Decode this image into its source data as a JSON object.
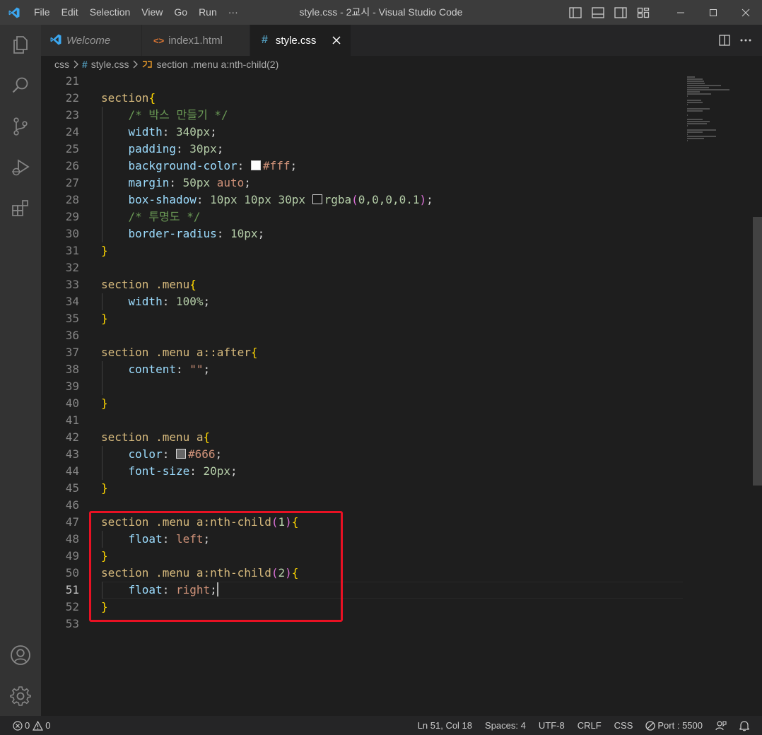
{
  "titlebar": {
    "menu": [
      "File",
      "Edit",
      "Selection",
      "View",
      "Go",
      "Run",
      "···"
    ],
    "title": "style.css - 2교시 - Visual Studio Code"
  },
  "tabs": [
    {
      "label": "Welcome",
      "icon": "vscode-icon",
      "active": false
    },
    {
      "label": "index1.html",
      "icon": "html-icon",
      "active": false
    },
    {
      "label": "style.css",
      "icon": "css-hash-icon",
      "active": true
    }
  ],
  "breadcrumb": {
    "folder": "css",
    "file": "style.css",
    "symbol": "section .menu a:nth-child(2)"
  },
  "editor": {
    "lines": [
      {
        "n": "21",
        "parts": []
      },
      {
        "n": "22",
        "parts": [
          [
            "sel",
            "section"
          ],
          [
            "br1",
            "{"
          ]
        ]
      },
      {
        "n": "23",
        "parts": [
          [
            "ind",
            "    "
          ],
          [
            "com",
            "/* 박스 만들기 */"
          ]
        ]
      },
      {
        "n": "24",
        "parts": [
          [
            "ind",
            "    "
          ],
          [
            "prop",
            "width"
          ],
          [
            "pun",
            ": "
          ],
          [
            "num",
            "340px"
          ],
          [
            "pun",
            ";"
          ]
        ]
      },
      {
        "n": "25",
        "parts": [
          [
            "ind",
            "    "
          ],
          [
            "prop",
            "padding"
          ],
          [
            "pun",
            ": "
          ],
          [
            "num",
            "30px"
          ],
          [
            "pun",
            ";"
          ]
        ]
      },
      {
        "n": "26",
        "parts": [
          [
            "ind",
            "    "
          ],
          [
            "prop",
            "background-color"
          ],
          [
            "pun",
            ": "
          ],
          [
            "swatch",
            "#ffffff"
          ],
          [
            "val",
            "#fff"
          ],
          [
            "pun",
            ";"
          ]
        ]
      },
      {
        "n": "27",
        "parts": [
          [
            "ind",
            "    "
          ],
          [
            "prop",
            "margin"
          ],
          [
            "pun",
            ": "
          ],
          [
            "num",
            "50px "
          ],
          [
            "val",
            "auto"
          ],
          [
            "pun",
            ";"
          ]
        ]
      },
      {
        "n": "28",
        "parts": [
          [
            "ind",
            "    "
          ],
          [
            "prop",
            "box-shadow"
          ],
          [
            "pun",
            ": "
          ],
          [
            "num",
            "10px 10px 30px "
          ],
          [
            "swatch",
            "rgba(0,0,0,0.1)"
          ],
          [
            "fn",
            "rgba"
          ],
          [
            "br2",
            "("
          ],
          [
            "num",
            "0,0,0,0.1"
          ],
          [
            "br2",
            ")"
          ],
          [
            "pun",
            ";"
          ]
        ]
      },
      {
        "n": "29",
        "parts": [
          [
            "ind",
            "    "
          ],
          [
            "com",
            "/* 투명도 */"
          ]
        ]
      },
      {
        "n": "30",
        "parts": [
          [
            "ind",
            "    "
          ],
          [
            "prop",
            "border-radius"
          ],
          [
            "pun",
            ": "
          ],
          [
            "num",
            "10px"
          ],
          [
            "pun",
            ";"
          ]
        ]
      },
      {
        "n": "31",
        "parts": [
          [
            "br1",
            "}"
          ]
        ]
      },
      {
        "n": "32",
        "parts": []
      },
      {
        "n": "33",
        "parts": [
          [
            "sel",
            "section .menu"
          ],
          [
            "br1",
            "{"
          ]
        ]
      },
      {
        "n": "34",
        "parts": [
          [
            "ind",
            "    "
          ],
          [
            "prop",
            "width"
          ],
          [
            "pun",
            ": "
          ],
          [
            "num",
            "100%"
          ],
          [
            "pun",
            ";"
          ]
        ]
      },
      {
        "n": "35",
        "parts": [
          [
            "br1",
            "}"
          ]
        ]
      },
      {
        "n": "36",
        "parts": []
      },
      {
        "n": "37",
        "parts": [
          [
            "sel",
            "section .menu a::after"
          ],
          [
            "br1",
            "{"
          ]
        ]
      },
      {
        "n": "38",
        "parts": [
          [
            "ind",
            "    "
          ],
          [
            "prop",
            "content"
          ],
          [
            "pun",
            ": "
          ],
          [
            "val",
            "\"\""
          ],
          [
            "pun",
            ";"
          ]
        ]
      },
      {
        "n": "39",
        "parts": []
      },
      {
        "n": "40",
        "parts": [
          [
            "br1",
            "}"
          ]
        ]
      },
      {
        "n": "41",
        "parts": []
      },
      {
        "n": "42",
        "parts": [
          [
            "sel",
            "section .menu a"
          ],
          [
            "br1",
            "{"
          ]
        ]
      },
      {
        "n": "43",
        "parts": [
          [
            "ind",
            "    "
          ],
          [
            "prop",
            "color"
          ],
          [
            "pun",
            ": "
          ],
          [
            "swatch",
            "#666666"
          ],
          [
            "val",
            "#666"
          ],
          [
            "pun",
            ";"
          ]
        ]
      },
      {
        "n": "44",
        "parts": [
          [
            "ind",
            "    "
          ],
          [
            "prop",
            "font-size"
          ],
          [
            "pun",
            ": "
          ],
          [
            "num",
            "20px"
          ],
          [
            "pun",
            ";"
          ]
        ]
      },
      {
        "n": "45",
        "parts": [
          [
            "br1",
            "}"
          ]
        ]
      },
      {
        "n": "46",
        "parts": []
      },
      {
        "n": "47",
        "parts": [
          [
            "sel",
            "section .menu a:nth-child"
          ],
          [
            "br2",
            "("
          ],
          [
            "num",
            "1"
          ],
          [
            "br2",
            ")"
          ],
          [
            "br1",
            "{"
          ]
        ]
      },
      {
        "n": "48",
        "parts": [
          [
            "ind",
            "    "
          ],
          [
            "prop",
            "float"
          ],
          [
            "pun",
            ": "
          ],
          [
            "val",
            "left"
          ],
          [
            "pun",
            ";"
          ]
        ]
      },
      {
        "n": "49",
        "parts": [
          [
            "br1",
            "}"
          ]
        ]
      },
      {
        "n": "50",
        "parts": [
          [
            "sel",
            "section .menu a:nth-child"
          ],
          [
            "br2",
            "("
          ],
          [
            "num",
            "2"
          ],
          [
            "br2",
            ")"
          ],
          [
            "br1",
            "{"
          ]
        ]
      },
      {
        "n": "51",
        "parts": [
          [
            "ind",
            "    "
          ],
          [
            "prop",
            "float"
          ],
          [
            "pun",
            ": "
          ],
          [
            "val",
            "right"
          ],
          [
            "pun",
            ";"
          ],
          [
            "cursor",
            ""
          ]
        ]
      },
      {
        "n": "52",
        "parts": [
          [
            "br1",
            "}"
          ]
        ]
      },
      {
        "n": "53",
        "parts": []
      }
    ],
    "current_line": "51"
  },
  "statusbar": {
    "errors": "0",
    "warnings": "0",
    "position": "Ln 51, Col 18",
    "spaces": "Spaces: 4",
    "encoding": "UTF-8",
    "eol": "CRLF",
    "language": "CSS",
    "port": "Port : 5500"
  },
  "colors": {
    "accent_tab_hash": "#519aba",
    "highlight_box": "#e81123",
    "selector": "#d7ba7d",
    "property": "#9cdcfe"
  }
}
